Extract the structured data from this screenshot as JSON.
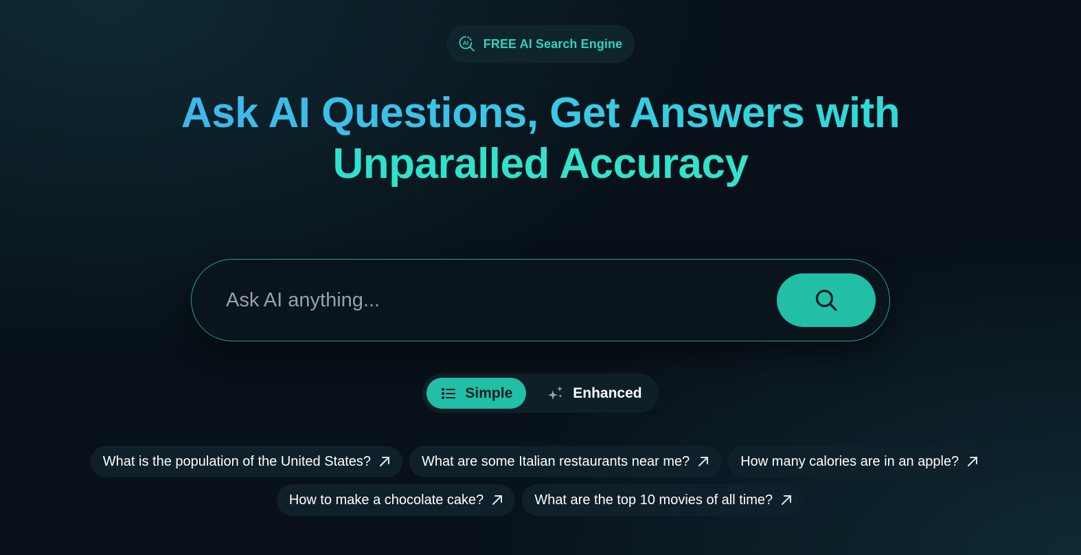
{
  "badge": {
    "icon": "ai-search-icon",
    "text": "FREE AI Search Engine"
  },
  "headline": {
    "line1": "Ask AI Questions, Get Answers with",
    "line2": "Unparalled Accuracy"
  },
  "search": {
    "placeholder": "Ask AI anything...",
    "value": "",
    "button_icon": "search-icon"
  },
  "modes": [
    {
      "label": "Simple",
      "icon": "list-icon",
      "active": true
    },
    {
      "label": "Enhanced",
      "icon": "sparkles-icon",
      "active": false
    }
  ],
  "suggestions": {
    "row1": [
      "What is the population of the United States?",
      "What are some Italian restaurants near me?",
      "How many calories are in an apple?"
    ],
    "row2": [
      "How to make a chocolate cake?",
      "What are the top 10 movies of all time?"
    ],
    "icon": "arrow-up-right-icon"
  },
  "colors": {
    "accent": "#20bfa6",
    "badge_text": "#2dd4bf",
    "background": "#081119",
    "chip_background": "#10202a"
  }
}
